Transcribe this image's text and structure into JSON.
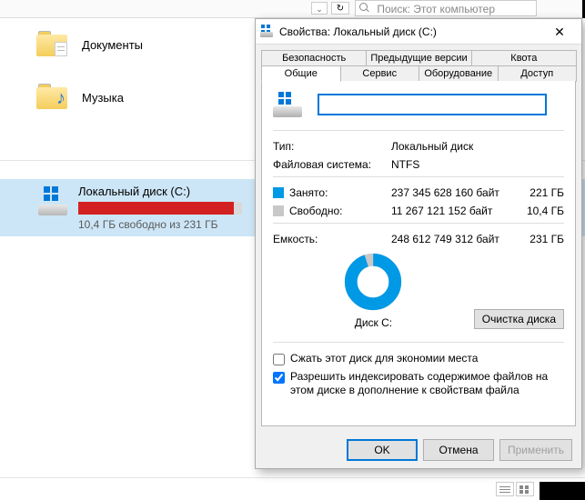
{
  "toolbar": {
    "search_placeholder": "Поиск: Этот компьютер"
  },
  "explorer": {
    "folders": [
      {
        "name": "Документы",
        "kind": "documents"
      },
      {
        "name": "Музыка",
        "kind": "music"
      }
    ],
    "drive": {
      "name": "Локальный диск (C:)",
      "free_text": "10,4 ГБ свободно из 231 ГБ",
      "fill_percent": 95,
      "bar_color_used": "#d32121"
    }
  },
  "dialog": {
    "title": "Свойства: Локальный диск (C:)",
    "tabs_row1": [
      "Безопасность",
      "Предыдущие версии",
      "Квота"
    ],
    "tabs_row2": [
      "Общие",
      "Сервис",
      "Оборудование",
      "Доступ"
    ],
    "active_tab": "Общие",
    "volume_label": "",
    "type_label": "Тип:",
    "type_value": "Локальный диск",
    "fs_label": "Файловая система:",
    "fs_value": "NTFS",
    "used_label": "Занято:",
    "used_bytes": "237 345 628 160 байт",
    "used_gb": "221 ГБ",
    "free_label": "Свободно:",
    "free_bytes": "11 267 121 152 байт",
    "free_gb": "10,4 ГБ",
    "capacity_label": "Емкость:",
    "capacity_bytes": "248 612 749 312 байт",
    "capacity_gb": "231 ГБ",
    "donut_label": "Диск C:",
    "donut_used_percent": 95,
    "donut_used_color": "#0099e5",
    "donut_free_color": "#c8c8c8",
    "cleanup_label": "Очистка диска",
    "checkbox_compress": "Сжать этот диск для экономии места",
    "checkbox_index": "Разрешить индексировать содержимое файлов на этом диске в дополнение к свойствам файла",
    "compress_checked": false,
    "index_checked": true,
    "ok_label": "OK",
    "cancel_label": "Отмена",
    "apply_label": "Применить"
  }
}
